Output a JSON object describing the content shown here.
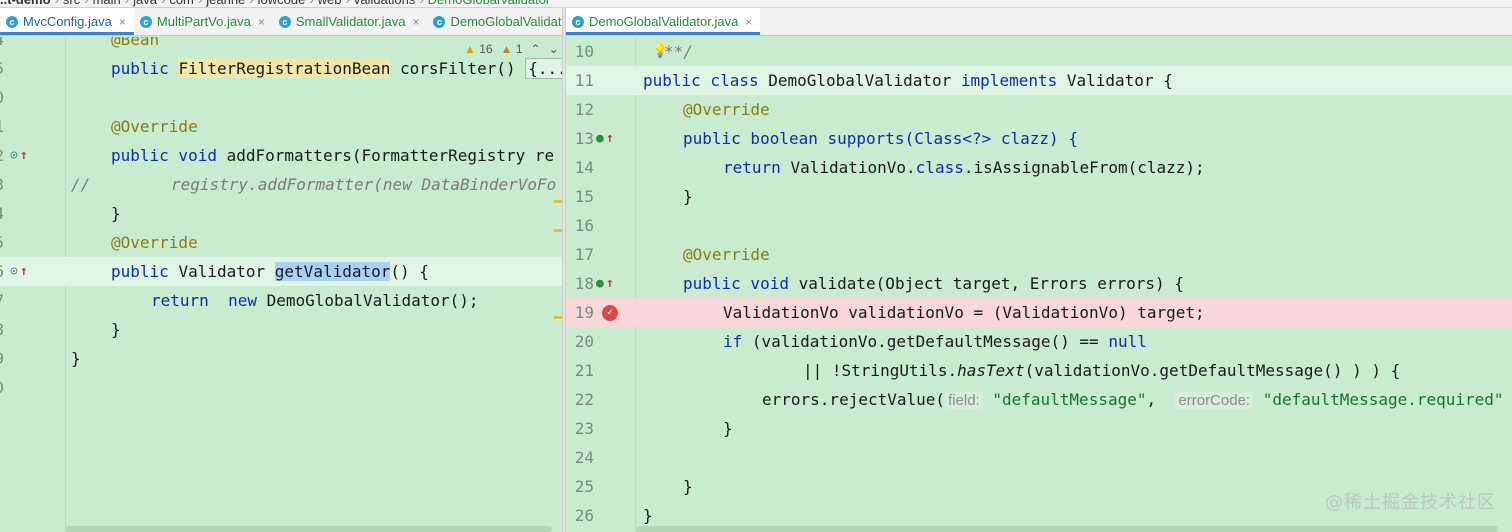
{
  "breadcrumb": {
    "items": [
      "..t-demo",
      "src",
      "main",
      "java",
      "com",
      "jeanne",
      "lowcode",
      "web",
      "validations",
      "DemoGlobalValidator"
    ]
  },
  "left_tabs": [
    {
      "label": "MvcConfig.java",
      "icon": "class-icon",
      "active": true
    },
    {
      "label": "MultiPartVo.java",
      "icon": "class-icon",
      "active": false
    },
    {
      "label": "SmallValidator.java",
      "icon": "class-icon",
      "active": false
    },
    {
      "label": "DemoGlobalValidator.",
      "icon": "class-icon",
      "active": false
    }
  ],
  "right_tabs": [
    {
      "label": "DemoGlobalValidator.java",
      "icon": "class-icon",
      "active": true
    }
  ],
  "inspection": {
    "warnings": "16",
    "weak_warnings": "1"
  },
  "left_editor": {
    "line_numbers": [
      "4",
      "5",
      "0",
      "1",
      "2",
      "3",
      "4",
      "5",
      "6",
      "7",
      "8",
      "9",
      "0"
    ],
    "lines": {
      "l0": "@Bean",
      "l1_kw": "public",
      "l1_type": "FilterRegistrationBean",
      "l1_rest": "corsFilter()",
      "l1_fold": "{...",
      "l3": "@Override",
      "l4_kw": "public void",
      "l4_rest": "addFormatters(FormatterRegistry re",
      "l5_cmt": "//",
      "l5_code": "registry.addFormatter(new DataBinderVoFo",
      "l6": "}",
      "l7": "@Override",
      "l8_kw": "public",
      "l8_type": "Validator",
      "l8_sel": "getValidator",
      "l8_rest": "() {",
      "l9_kw1": "return",
      "l9_kw2": "new",
      "l9_rest": "DemoGlobalValidator();",
      "l10": "}",
      "l11": "}"
    }
  },
  "right_editor": {
    "line_numbers": [
      "10",
      "11",
      "12",
      "13",
      "14",
      "15",
      "16",
      "17",
      "18",
      "19",
      "20",
      "21",
      "22",
      "23",
      "24",
      "25",
      "26"
    ],
    "lines": {
      "r10": "**/",
      "r11_kw1": "public class",
      "r11_name": "DemoGlobalValidator",
      "r11_kw2": "implements",
      "r11_rest": "Validator {",
      "r12": "@Override",
      "r13_kw": "public boolean",
      "r13_rest": "supports(Class<?> clazz) {",
      "r14_kw": "return",
      "r14_a": "ValidationVo.",
      "r14_kw2": "class",
      "r14_b": ".isAssignableFrom(clazz);",
      "r15": "}",
      "r17": "@Override",
      "r18_kw": "public void",
      "r18_rest": "validate(Object target, Errors errors) {",
      "r19": "ValidationVo validationVo = (ValidationVo) target;",
      "r20_kw": "if",
      "r20_a": "(validationVo.getDefaultMessage() ==",
      "r20_kw2": "null",
      "r21_a": "|| !StringUtils.",
      "r21_ital": "hasText",
      "r21_b": "(validationVo.getDefaultMessage() ) ) {",
      "r22_a": "errors.rejectValue(",
      "r22_hint1": "field:",
      "r22_str1": "\"defaultMessage\"",
      "r22_comma": ",",
      "r22_hint2": "errorCode:",
      "r22_str2": "\"defaultMessage.required\"",
      "r23": "}",
      "r25": "}",
      "r26": "}"
    }
  },
  "watermark": "@稀土掘金技术社区",
  "colors": {
    "background": "#c9ecd0",
    "keyword": "#0b2fa8",
    "annotation": "#8a7a14",
    "string": "#13742c",
    "breakpoint_line": "#f7d7d7",
    "accent": "#4083c9"
  }
}
